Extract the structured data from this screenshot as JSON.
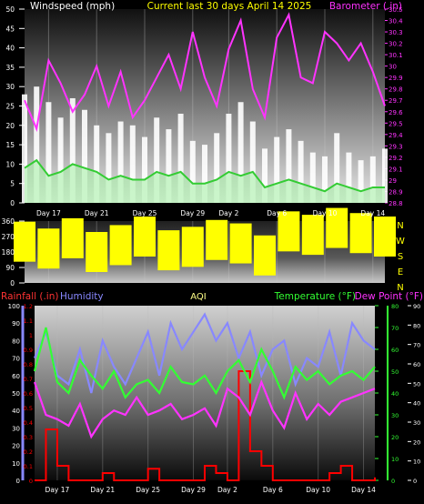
{
  "title": "Current last 30 days April 14 2025",
  "colors": {
    "title": "#ffff00",
    "wind": "#ffffff",
    "wind_avg": "#33cc33",
    "barometer": "#ff33ff",
    "direction": "#ffff00",
    "rain": "#ff0000",
    "humidity": "#8888ff",
    "aqi": "#ffff88",
    "temperature": "#33ff33",
    "dewpoint": "#ff33ff",
    "tick": "#ffffff"
  },
  "date_labels": [
    "Day 17",
    "Day 21",
    "Day 25",
    "Day 29",
    "Day 2",
    "Day 6",
    "Day 10",
    "Day 14"
  ],
  "compass": [
    "N",
    "W",
    "S",
    "E",
    "N"
  ],
  "chart_data": [
    {
      "type": "line",
      "name": "wind-barometer",
      "y_left_label": "Windspeed (mph)",
      "y_right_label": "Barometer (.in)",
      "ylim": [
        0,
        50
      ],
      "y2lim": [
        28.8,
        30.5
      ],
      "y_ticks": [
        "50",
        "45",
        "40",
        "35",
        "30",
        "25",
        "20",
        "15",
        "10",
        "5",
        "0"
      ],
      "y2_ticks": [
        "30.5",
        "30.4",
        "30.3",
        "30.2",
        "30.1",
        "30",
        "29.9",
        "29.8",
        "29.7",
        "29.6",
        "29.5",
        "29.4",
        "29.3",
        "29.2",
        "29.1",
        "29",
        "28.9",
        "28.8"
      ],
      "x_day_range": [
        15,
        45
      ],
      "series": [
        {
          "name": "Windspeed (mph)",
          "kind": "gust",
          "x": [
            15,
            16,
            17,
            18,
            19,
            20,
            21,
            22,
            23,
            24,
            25,
            26,
            27,
            28,
            29,
            30,
            31,
            32,
            33,
            34,
            35,
            36,
            37,
            38,
            39,
            40,
            41,
            42,
            43,
            44,
            45
          ],
          "values": [
            28,
            30,
            26,
            22,
            27,
            24,
            20,
            18,
            21,
            20,
            17,
            22,
            19,
            23,
            16,
            15,
            18,
            23,
            26,
            21,
            14,
            17,
            19,
            16,
            13,
            12,
            18,
            13,
            11,
            12,
            14
          ]
        },
        {
          "name": "Windspeed average",
          "kind": "avg",
          "x": [
            15,
            16,
            17,
            18,
            19,
            20,
            21,
            22,
            23,
            24,
            25,
            26,
            27,
            28,
            29,
            30,
            31,
            32,
            33,
            34,
            35,
            36,
            37,
            38,
            39,
            40,
            41,
            42,
            43,
            44,
            45
          ],
          "values": [
            9,
            11,
            7,
            8,
            10,
            9,
            8,
            6,
            7,
            6,
            6,
            8,
            7,
            8,
            5,
            5,
            6,
            8,
            7,
            8,
            4,
            5,
            6,
            5,
            4,
            3,
            5,
            4,
            3,
            4,
            4
          ]
        },
        {
          "name": "Barometer (.in)",
          "x": [
            15,
            16,
            17,
            18,
            19,
            20,
            21,
            22,
            23,
            24,
            25,
            26,
            27,
            28,
            29,
            30,
            31,
            32,
            33,
            34,
            35,
            36,
            37,
            38,
            39,
            40,
            41,
            42,
            43,
            44,
            45
          ],
          "values": [
            29.7,
            29.45,
            30.05,
            29.85,
            29.6,
            29.75,
            30.0,
            29.65,
            29.95,
            29.55,
            29.7,
            29.9,
            30.1,
            29.8,
            30.3,
            29.9,
            29.65,
            30.15,
            30.4,
            29.8,
            29.55,
            30.25,
            30.45,
            29.9,
            29.85,
            30.3,
            30.2,
            30.05,
            30.2,
            29.95,
            29.65
          ]
        }
      ]
    },
    {
      "type": "scatter",
      "name": "wind-direction",
      "ylim": [
        0,
        360
      ],
      "y_ticks": [
        "360",
        "270",
        "180",
        "90",
        "0"
      ],
      "x_day_range": [
        15,
        45
      ],
      "series": [
        {
          "name": "Direction",
          "x": [
            15,
            17,
            19,
            21,
            23,
            25,
            27,
            29,
            31,
            33,
            35,
            37,
            39,
            41,
            43,
            45
          ],
          "values": [
            240,
            200,
            260,
            180,
            220,
            270,
            190,
            210,
            250,
            230,
            160,
            300,
            280,
            320,
            290,
            270
          ]
        }
      ]
    },
    {
      "type": "line",
      "name": "rain-humidity-temperature",
      "y_rain_label": "Rainfall (.in)",
      "y_hum_label": "Humidity",
      "aqi_label": "AQI",
      "y_temp_label": "Temperature (°F)",
      "y_dew_label": "Dew Point (°F)",
      "rain_lim": [
        0,
        1.2
      ],
      "hum_lim": [
        0,
        100
      ],
      "temp_lim": [
        0,
        80
      ],
      "y_rain_ticks": [
        "1.2",
        "1.1",
        "1",
        "0.9",
        "0.8",
        "0.7",
        "0.6",
        "0.5",
        "0.4",
        "0.3",
        "0.2",
        "0.1",
        "0"
      ],
      "y_hum_ticks": [
        "100",
        "90",
        "80",
        "70",
        "60",
        "50",
        "40",
        "30",
        "20",
        "10",
        "0"
      ],
      "y_temp_ticks": [
        "80",
        "70",
        "60",
        "50",
        "40",
        "30",
        "20",
        "10",
        "0"
      ],
      "y_dew_ticks": [
        "90",
        "80",
        "70",
        "60",
        "50",
        "40",
        "30",
        "20",
        "10",
        "0"
      ],
      "x_day_range": [
        15,
        45
      ],
      "series": [
        {
          "name": "Rainfall (.in)",
          "x": [
            15,
            16,
            17,
            18,
            19,
            20,
            21,
            22,
            23,
            24,
            25,
            26,
            27,
            28,
            29,
            30,
            31,
            32,
            33,
            34,
            35,
            36,
            37,
            38,
            39,
            40,
            41,
            42,
            43,
            44,
            45
          ],
          "values": [
            0,
            0.35,
            0.1,
            0,
            0,
            0,
            0.05,
            0,
            0,
            0,
            0.08,
            0,
            0,
            0,
            0,
            0.1,
            0.05,
            0,
            0.75,
            0.2,
            0.1,
            0,
            0,
            0,
            0,
            0,
            0.05,
            0.1,
            0,
            0,
            0.02
          ]
        },
        {
          "name": "Humidity",
          "x": [
            15,
            16,
            17,
            18,
            19,
            20,
            21,
            22,
            23,
            24,
            25,
            26,
            27,
            28,
            29,
            30,
            31,
            32,
            33,
            34,
            35,
            36,
            37,
            38,
            39,
            40,
            41,
            42,
            43,
            44,
            45
          ],
          "values": [
            70,
            85,
            60,
            55,
            75,
            50,
            80,
            65,
            55,
            70,
            85,
            60,
            90,
            75,
            85,
            95,
            80,
            90,
            70,
            85,
            60,
            75,
            80,
            55,
            70,
            65,
            85,
            60,
            90,
            80,
            75
          ]
        },
        {
          "name": "Temperature (°F)",
          "x": [
            15,
            16,
            17,
            18,
            19,
            20,
            21,
            22,
            23,
            24,
            25,
            26,
            27,
            28,
            29,
            30,
            31,
            32,
            33,
            34,
            35,
            36,
            37,
            38,
            39,
            40,
            41,
            42,
            43,
            44,
            45
          ],
          "values": [
            50,
            70,
            45,
            40,
            55,
            48,
            42,
            50,
            38,
            44,
            46,
            40,
            52,
            45,
            44,
            48,
            40,
            50,
            55,
            45,
            60,
            50,
            38,
            52,
            46,
            50,
            44,
            48,
            50,
            46,
            52
          ]
        },
        {
          "name": "Dew Point (°F)",
          "x": [
            15,
            16,
            17,
            18,
            19,
            20,
            21,
            22,
            23,
            24,
            25,
            26,
            27,
            28,
            29,
            30,
            31,
            32,
            33,
            34,
            35,
            36,
            37,
            38,
            39,
            40,
            41,
            42,
            43,
            44,
            45
          ],
          "values": [
            45,
            30,
            28,
            25,
            35,
            20,
            28,
            32,
            30,
            38,
            30,
            32,
            35,
            28,
            30,
            33,
            25,
            42,
            38,
            30,
            45,
            32,
            24,
            40,
            28,
            35,
            30,
            36,
            38,
            40,
            42
          ]
        }
      ]
    }
  ]
}
